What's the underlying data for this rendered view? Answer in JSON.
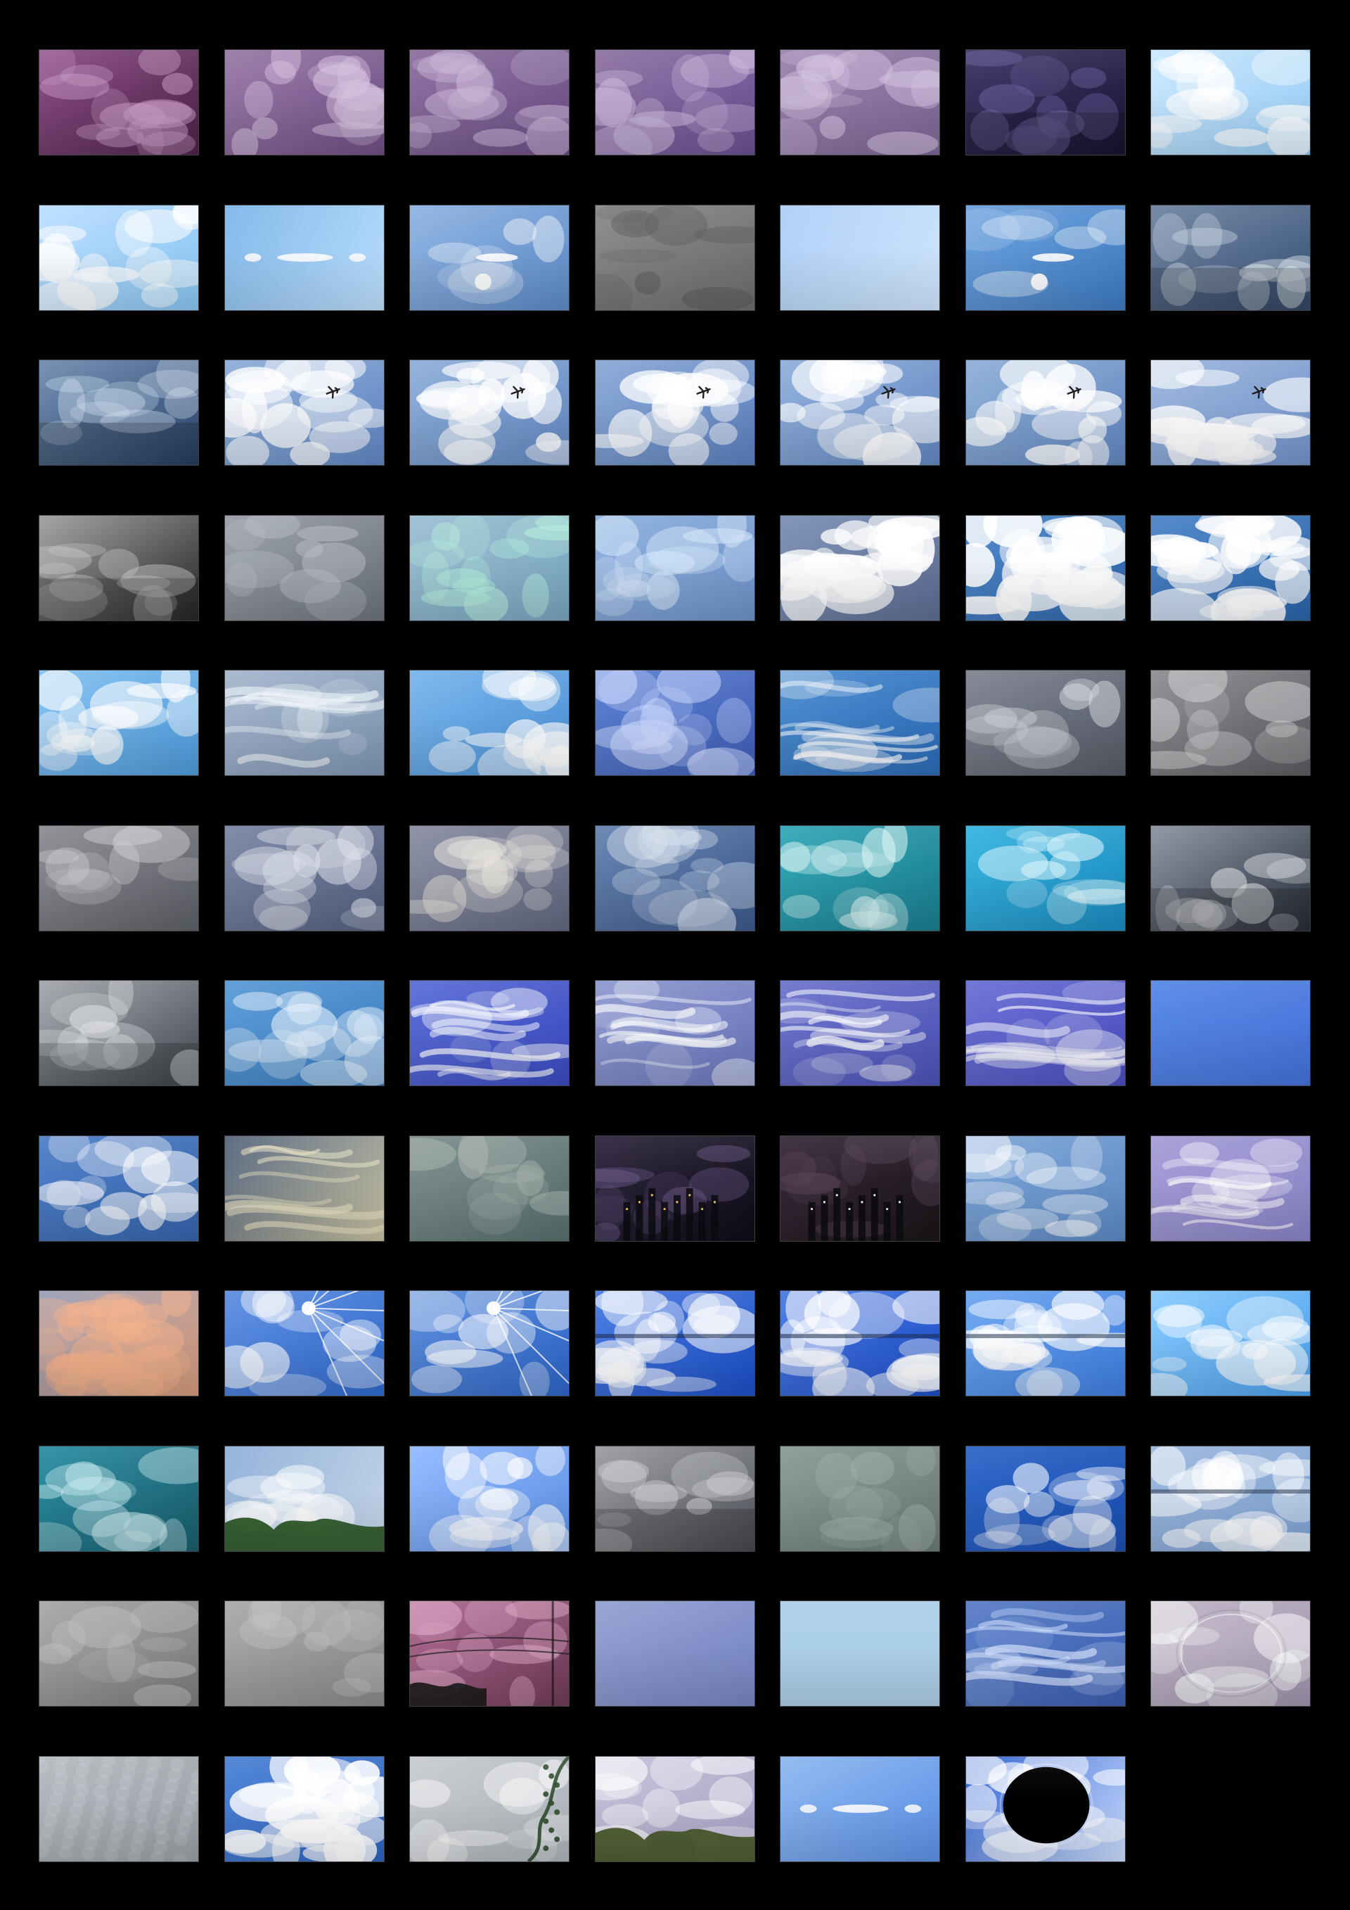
{
  "grid": {
    "background": "#000000",
    "thumbnails": [
      {
        "variant": "pink-clouds",
        "bg": "#8a4f86",
        "bg2": "#4f2248",
        "cloud": "#c99bc6",
        "accent": ""
      },
      {
        "variant": "clouds",
        "bg": "#9a7aa8",
        "bg2": "#6f4f86",
        "cloud": "#d8c2df",
        "accent": ""
      },
      {
        "variant": "clouds",
        "bg": "#8d6fa0",
        "bg2": "#6b4f86",
        "cloud": "#cdb6d7",
        "accent": ""
      },
      {
        "variant": "clouds",
        "bg": "#8f73a4",
        "bg2": "#6a5090",
        "cloud": "#c8b5da",
        "accent": ""
      },
      {
        "variant": "clouds",
        "bg": "#9a84ad",
        "bg2": "#7d6596",
        "cloud": "#d6c4e1",
        "accent": ""
      },
      {
        "variant": "storm",
        "bg": "#3f3564",
        "bg2": "#1e173a",
        "cloud": "#6e63a0",
        "accent": ""
      },
      {
        "variant": "bright",
        "bg": "#c8e7ff",
        "bg2": "#8fc8f3",
        "cloud": "#ffffff",
        "accent": ""
      },
      {
        "variant": "bright",
        "bg": "#b7dcff",
        "bg2": "#7fc1f2",
        "cloud": "#ffffff",
        "accent": ""
      },
      {
        "variant": "glare",
        "bg": "#7eb6e9",
        "bg2": "#bfe2ff",
        "cloud": "#ffffff",
        "accent": "#ffffff"
      },
      {
        "variant": "moon",
        "bg": "#8fb5e3",
        "bg2": "#5e8bc8",
        "cloud": "#ffffff",
        "accent": "#ffffff"
      },
      {
        "variant": "grey",
        "bg": "#8b8b8b",
        "bg2": "#6d6d6d",
        "cloud": "#5b5b5b",
        "accent": ""
      },
      {
        "variant": "plain",
        "bg": "#a9cdf6",
        "bg2": "#cfe6ff",
        "cloud": "#ffffff",
        "accent": ""
      },
      {
        "variant": "moon",
        "bg": "#6ea3df",
        "bg2": "#3e7bc1",
        "cloud": "#ffffff",
        "accent": "#ffffff"
      },
      {
        "variant": "storm",
        "bg": "#6f84a3",
        "bg2": "#3d5679",
        "cloud": "#e0e9f2",
        "accent": ""
      },
      {
        "variant": "storm",
        "bg": "#6f8db0",
        "bg2": "#2f4b73",
        "cloud": "#d9e6f4",
        "accent": ""
      },
      {
        "variant": "plane",
        "bg": "#8eaed8",
        "bg2": "#6187c3",
        "cloud": "#ffffff",
        "accent": "#1b1b1b"
      },
      {
        "variant": "plane",
        "bg": "#8fb0da",
        "bg2": "#6388c2",
        "cloud": "#ffffff",
        "accent": "#1b1b1b"
      },
      {
        "variant": "plane",
        "bg": "#8aa9d6",
        "bg2": "#5c81bf",
        "cloud": "#ffffff",
        "accent": "#1b1b1b"
      },
      {
        "variant": "plane",
        "bg": "#90b0db",
        "bg2": "#6488c3",
        "cloud": "#ffffff",
        "accent": "#1b1b1b"
      },
      {
        "variant": "plane",
        "bg": "#8fb0d8",
        "bg2": "#6387c1",
        "cloud": "#ffffff",
        "accent": "#1b1b1b"
      },
      {
        "variant": "plane",
        "bg": "#9cb7de",
        "bg2": "#7393ca",
        "cloud": "#ffffff",
        "accent": "#1b1b1b"
      },
      {
        "variant": "storm",
        "bg": "#a0a0a0",
        "bg2": "#2d2d2d",
        "cloud": "#d0d0d0",
        "accent": ""
      },
      {
        "variant": "grey",
        "bg": "#9aa0a8",
        "bg2": "#6c737c",
        "cloud": "#b9bec5",
        "accent": ""
      },
      {
        "variant": "clouds",
        "bg": "#9cbfd2",
        "bg2": "#77a6c0",
        "cloud": "#b8f0dd",
        "accent": ""
      },
      {
        "variant": "clouds",
        "bg": "#8fb1de",
        "bg2": "#6d92c9",
        "cloud": "#d8e8fb",
        "accent": ""
      },
      {
        "variant": "puffy",
        "bg": "#7c90b4",
        "bg2": "#5d6e93",
        "cloud": "#ffffff",
        "accent": ""
      },
      {
        "variant": "puffy",
        "bg": "#4f87c9",
        "bg2": "#2f67ac",
        "cloud": "#ffffff",
        "accent": ""
      },
      {
        "variant": "puffy",
        "bg": "#4d85c7",
        "bg2": "#2a64aa",
        "cloud": "#ffffff",
        "accent": ""
      },
      {
        "variant": "bright",
        "bg": "#7cbdf0",
        "bg2": "#3f93d9",
        "cloud": "#ffffff",
        "accent": ""
      },
      {
        "variant": "wispy",
        "bg": "#a5b7cd",
        "bg2": "#7f96b3",
        "cloud": "#eef3f8",
        "accent": ""
      },
      {
        "variant": "bright",
        "bg": "#6fb0ec",
        "bg2": "#3b86d1",
        "cloud": "#ffffff",
        "accent": ""
      },
      {
        "variant": "clouds",
        "bg": "#5c7fd0",
        "bg2": "#3f5fb7",
        "cloud": "#cfdcff",
        "accent": ""
      },
      {
        "variant": "wispy",
        "bg": "#4d8dd0",
        "bg2": "#2c6cb7",
        "cloud": "#ffffff",
        "accent": ""
      },
      {
        "variant": "grey",
        "bg": "#7f8591",
        "bg2": "#565c67",
        "cloud": "#d8dbe1",
        "accent": ""
      },
      {
        "variant": "grey",
        "bg": "#8e8f92",
        "bg2": "#5b5c60",
        "cloud": "#d2d3d6",
        "accent": ""
      },
      {
        "variant": "grey",
        "bg": "#8c8d94",
        "bg2": "#5e6068",
        "cloud": "#d3d4d8",
        "accent": ""
      },
      {
        "variant": "clouds",
        "bg": "#7c86a4",
        "bg2": "#566182",
        "cloud": "#dde1ea",
        "accent": ""
      },
      {
        "variant": "clouds",
        "bg": "#8a8ea3",
        "bg2": "#626880",
        "cloud": "#e9e6dd",
        "accent": ""
      },
      {
        "variant": "clouds",
        "bg": "#6582b0",
        "bg2": "#3d5a8c",
        "cloud": "#d8e1ee",
        "accent": ""
      },
      {
        "variant": "teal",
        "bg": "#33a8b8",
        "bg2": "#1a7f8f",
        "cloud": "#dff7f6",
        "accent": ""
      },
      {
        "variant": "teal",
        "bg": "#38b4df",
        "bg2": "#1b8cc0",
        "cloud": "#e6fbff",
        "accent": ""
      },
      {
        "variant": "storm",
        "bg": "#8b94a2",
        "bg2": "#2f3642",
        "cloud": "#e4e6ea",
        "accent": ""
      },
      {
        "variant": "storm",
        "bg": "#a4a8ae",
        "bg2": "#4a5058",
        "cloud": "#dee1e5",
        "accent": ""
      },
      {
        "variant": "clouds",
        "bg": "#5b9bd7",
        "bg2": "#3a7dc0",
        "cloud": "#e6f1fb",
        "accent": ""
      },
      {
        "variant": "wispy",
        "bg": "#5a6ed6",
        "bg2": "#3b4bc1",
        "cloud": "#ffffff",
        "accent": ""
      },
      {
        "variant": "wispy",
        "bg": "#8f9ad0",
        "bg2": "#6a77bc",
        "cloud": "#ffffff",
        "accent": ""
      },
      {
        "variant": "wispy",
        "bg": "#6e75cc",
        "bg2": "#4b53b7",
        "cloud": "#ffffff",
        "accent": ""
      },
      {
        "variant": "wispy",
        "bg": "#6b70d4",
        "bg2": "#4a4fc0",
        "cloud": "#ffffff",
        "accent": ""
      },
      {
        "variant": "plain",
        "bg": "#4d82e6",
        "bg2": "#3a6ad8",
        "cloud": "#ffffff",
        "accent": ""
      },
      {
        "variant": "clouds",
        "bg": "#4f7fc6",
        "bg2": "#3565ae",
        "cloud": "#ffffff",
        "accent": ""
      },
      {
        "variant": "dusk",
        "bg": "#56667e",
        "bg2": "#c9c3a3",
        "cloud": "#e9e1c2",
        "accent": ""
      },
      {
        "variant": "grey",
        "bg": "#7f8e8d",
        "bg2": "#56706f",
        "cloud": "#aeb7b4",
        "accent": ""
      },
      {
        "variant": "night",
        "bg": "#2f2740",
        "bg2": "#0f0c16",
        "cloud": "#6c5a88",
        "accent": "#ffd36a"
      },
      {
        "variant": "night",
        "bg": "#3a2a3b",
        "bg2": "#1a1418",
        "cloud": "#5a475a",
        "accent": "#ffffff"
      },
      {
        "variant": "clouds",
        "bg": "#7ea6d6",
        "bg2": "#5d8ac5",
        "cloud": "#ffffff",
        "accent": ""
      },
      {
        "variant": "wispy",
        "bg": "#a59ed8",
        "bg2": "#8a84c7",
        "cloud": "#ffffff",
        "accent": ""
      },
      {
        "variant": "sunset",
        "bg": "#9aa0b8",
        "bg2": "#d79a7a",
        "cloud": "#f2b08a",
        "accent": ""
      },
      {
        "variant": "sunburst",
        "bg": "#5f8fe1",
        "bg2": "#2f69cc",
        "cloud": "#ffffff",
        "accent": "#ffffff"
      },
      {
        "variant": "sunburst",
        "bg": "#5d8edc",
        "bg2": "#2e66c8",
        "cloud": "#ffffff",
        "accent": "#ffffff"
      },
      {
        "variant": "reflect",
        "bg": "#4b7be0",
        "bg2": "#1c4fc7",
        "cloud": "#ffffff",
        "accent": "#1c2a4b"
      },
      {
        "variant": "reflect",
        "bg": "#4a7ae3",
        "bg2": "#1c4dc6",
        "cloud": "#ffffff",
        "accent": "#1c2a4b"
      },
      {
        "variant": "reflect",
        "bg": "#6ea6f0",
        "bg2": "#3f7fe0",
        "cloud": "#ffffff",
        "accent": "#23364d"
      },
      {
        "variant": "bright",
        "bg": "#7fc7ff",
        "bg2": "#3c98ea",
        "cloud": "#ffffff",
        "accent": ""
      },
      {
        "variant": "teal",
        "bg": "#2b8ea2",
        "bg2": "#1a5e6d",
        "cloud": "#cfeef2",
        "accent": ""
      },
      {
        "variant": "trees",
        "bg": "#8fb0d8",
        "bg2": "#c9d8ea",
        "cloud": "#ffffff",
        "accent": "#2f5a2a"
      },
      {
        "variant": "bright",
        "bg": "#8bb3ff",
        "bg2": "#4e88e2",
        "cloud": "#ffffff",
        "accent": ""
      },
      {
        "variant": "storm",
        "bg": "#9a9ca2",
        "bg2": "#55585f",
        "cloud": "#d7d8dc",
        "accent": ""
      },
      {
        "variant": "grey",
        "bg": "#8b9a94",
        "bg2": "#6b7b75",
        "cloud": "#a8b6b0",
        "accent": ""
      },
      {
        "variant": "clouds",
        "bg": "#2e66c8",
        "bg2": "#1a4fb3",
        "cloud": "#ffffff",
        "accent": ""
      },
      {
        "variant": "reflect",
        "bg": "#9bb7de",
        "bg2": "#7fa3d2",
        "cloud": "#ffffff",
        "accent": "#2c3b54"
      },
      {
        "variant": "grey",
        "bg": "#a8a8a8",
        "bg2": "#7c7c7c",
        "cloud": "#bfbfbf",
        "accent": ""
      },
      {
        "variant": "grey",
        "bg": "#a9a9a9",
        "bg2": "#8a8a8a",
        "cloud": "#c2c2c2",
        "accent": ""
      },
      {
        "variant": "pink-power",
        "bg": "#b06b92",
        "bg2": "#6f3b58",
        "cloud": "#e4b2cf",
        "accent": "#1a1a1a"
      },
      {
        "variant": "plain",
        "bg": "#8e9ad0",
        "bg2": "#6f7fc2",
        "cloud": "#cfd8ff",
        "accent": ""
      },
      {
        "variant": "plain",
        "bg": "#a7cce8",
        "bg2": "#a7cce8",
        "cloud": "#ffffff",
        "accent": ""
      },
      {
        "variant": "wispy",
        "bg": "#5a7ec7",
        "bg2": "#3b5fb1",
        "cloud": "#d6e3ff",
        "accent": ""
      },
      {
        "variant": "bubble",
        "bg": "#c1b6c6",
        "bg2": "#9f93ad",
        "cloud": "#ffffff",
        "accent": "#2a2a2a"
      },
      {
        "variant": "texture",
        "bg": "#b4b9bf",
        "bg2": "#9aa0a6",
        "cloud": "#d8dce1",
        "accent": ""
      },
      {
        "variant": "puffy",
        "bg": "#4d82d6",
        "bg2": "#2f64be",
        "cloud": "#ffffff",
        "accent": ""
      },
      {
        "variant": "vines",
        "bg": "#c8cbd0",
        "bg2": "#aeb4bb",
        "cloud": "#ffffff",
        "accent": "#2f4d2f"
      },
      {
        "variant": "trees2",
        "bg": "#c7c1d9",
        "bg2": "#a9a3c6",
        "cloud": "#ffffff",
        "accent": "#4a5a2c"
      },
      {
        "variant": "glare",
        "bg": "#8fb8f0",
        "bg2": "#5c92e6",
        "cloud": "#ffffff",
        "accent": "#ffffff"
      },
      {
        "variant": "eclipse",
        "bg": "#2d5fd0",
        "bg2": "#cfe1ff",
        "cloud": "#ffffff",
        "accent": "#000000"
      }
    ]
  }
}
